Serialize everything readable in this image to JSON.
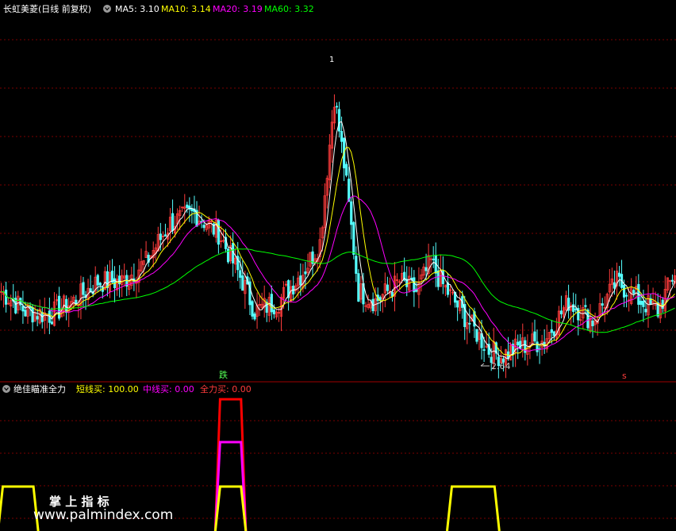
{
  "colors": {
    "bg": "#000000",
    "up": "#ff3c3c",
    "down": "#54ffff",
    "ma5": "#ffffff",
    "ma10": "#ffff00",
    "ma20": "#ff00ff",
    "ma60": "#00ff00",
    "grid": "#7a0000",
    "short": "#ffff00",
    "mid": "#ff00ff",
    "full": "#ff0000"
  },
  "header": {
    "title": "长虹美菱(日线 前复权)",
    "ma5": "MA5: 3.10",
    "ma10": "MA10: 3.14",
    "ma20": "MA20: 3.19",
    "ma60": "MA60: 3.32"
  },
  "annotations": {
    "low_label": "2.64",
    "peak_marker": "1",
    "signal_left": "跌",
    "signal_right": "s"
  },
  "indicator": {
    "title": "绝佳瞄准全力",
    "short": "短线买: 100.00",
    "mid": "中线买: 0.00",
    "full": "全力买: 0.00"
  },
  "watermark": {
    "line1": "掌 上 指 标",
    "line2": "www.palmindex.com"
  },
  "chart_data": {
    "type": "candlestick",
    "y_axis_min_visible": 2.64,
    "anchors": [
      [
        0,
        3.0
      ],
      [
        10,
        2.9
      ],
      [
        20,
        2.88
      ],
      [
        30,
        2.95
      ],
      [
        40,
        3.05
      ],
      [
        50,
        3.05
      ],
      [
        60,
        3.15
      ],
      [
        70,
        3.35
      ],
      [
        80,
        3.4
      ],
      [
        90,
        3.3
      ],
      [
        100,
        3.05
      ],
      [
        105,
        2.9
      ],
      [
        115,
        2.95
      ],
      [
        125,
        3.1
      ],
      [
        132,
        3.25
      ],
      [
        138,
        4.0
      ],
      [
        142,
        3.65
      ],
      [
        148,
        3.0
      ],
      [
        155,
        2.95
      ],
      [
        165,
        3.05
      ],
      [
        172,
        3.0
      ],
      [
        178,
        3.15
      ],
      [
        182,
        3.05
      ],
      [
        195,
        2.82
      ],
      [
        202,
        2.7
      ],
      [
        207,
        2.67
      ],
      [
        215,
        2.72
      ],
      [
        225,
        2.75
      ],
      [
        235,
        2.95
      ],
      [
        245,
        2.85
      ],
      [
        255,
        3.05
      ],
      [
        265,
        2.95
      ],
      [
        272,
        2.9
      ],
      [
        279,
        3.1
      ]
    ],
    "count": 280,
    "seed": 7,
    "indicator_series": {
      "short_pulses": [
        [
          0,
          14
        ],
        [
          186,
          205
        ]
      ],
      "mid_pulses": [
        [
          90,
          100
        ]
      ],
      "full_pulses": [
        [
          90,
          100
        ]
      ]
    }
  }
}
